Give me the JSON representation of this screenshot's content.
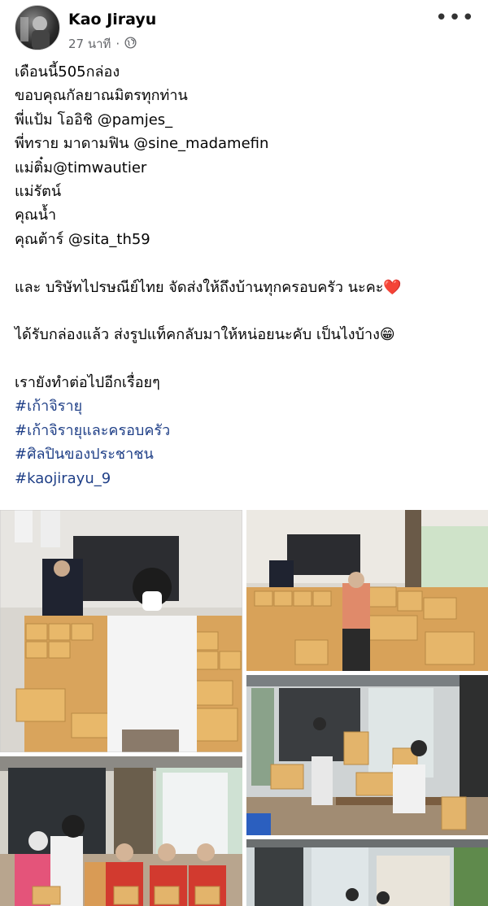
{
  "post": {
    "author": "Kao Jirayu",
    "time": "27 นาที",
    "dot": "·",
    "more": "•••",
    "lines": [
      "เดือนนี้505กล่อง",
      "ขอบคุณกัลยาณมิตรทุกท่าน",
      "พี่แป้ม โออิชิ @pamjes_",
      "พี่ทราย มาดามฟิน @sine_madamefin",
      "แม่ติ๋ม@timwautier",
      "แม่รัตน์",
      "คุณน้ำ",
      "คุณต้าร์ @sita_th59",
      "และ บริษัทไปรษณีย์ไทย จัดส่งให้ถึงบ้านทุกครอบครัว นะคะ❤️",
      "ได้รับกล่องแล้ว ส่งรูปแท็คกลับมาให้หน่อยนะคับ เป็นไงบ้าง😁",
      "เรายังทำต่อไปอีกเรื่อยๆ"
    ],
    "hashtags": [
      "#เก้าจิรายุ",
      "#เก้าจิรายุและครอบครัว",
      "#ศิลปินของประชาชน",
      "#kaojirayu_9"
    ]
  },
  "icons": {
    "privacy": "globe-icon",
    "more": "more-options-icon"
  }
}
